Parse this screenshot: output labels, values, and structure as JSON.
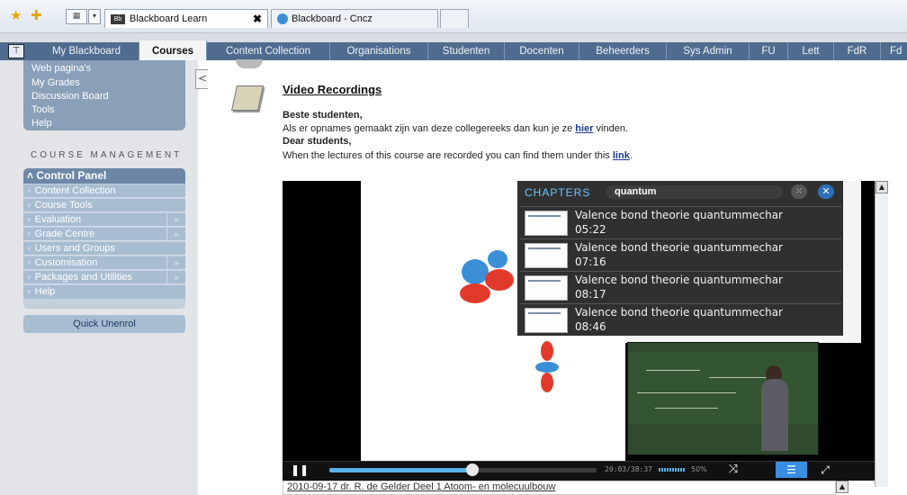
{
  "browser": {
    "tabs": [
      {
        "label": "Blackboard Learn",
        "favicon": "Bb"
      },
      {
        "label": "Blackboard - Cncz"
      },
      {
        "label": ""
      }
    ],
    "close_glyph": "✖"
  },
  "nav": {
    "tabs": [
      "My Blackboard",
      "Courses",
      "Content Collection",
      "Organisations",
      "Studenten",
      "Docenten",
      "Beheerders",
      "Sys Admin",
      "FU",
      "Lett",
      "FdR",
      "Fd"
    ],
    "active": "Courses"
  },
  "sidebar": {
    "tool_links": [
      "Web pagina's",
      "My Grades",
      "Discussion Board",
      "Tools",
      "Help"
    ],
    "collapse_glyph": "<",
    "course_management_heading": "COURSE MANAGEMENT",
    "control_panel": {
      "title": "Control Panel",
      "items": [
        {
          "label": "Content Collection",
          "has_submenu": false
        },
        {
          "label": "Course Tools",
          "has_submenu": false
        },
        {
          "label": "Evaluation",
          "has_submenu": true
        },
        {
          "label": "Grade Centre",
          "has_submenu": true
        },
        {
          "label": "Users and Groups",
          "has_submenu": false
        },
        {
          "label": "Customisation",
          "has_submenu": true
        },
        {
          "label": "Packages and Utilities",
          "has_submenu": true
        },
        {
          "label": "Help",
          "has_submenu": false
        }
      ],
      "submenu_glyph": "»",
      "expand_glyph": "»"
    },
    "quick_unenrol": "Quick Unenrol"
  },
  "content": {
    "title": "Video Recordings",
    "greeting_nl": "Beste studenten,",
    "line_nl_before": "Als er opnames gemaakt zijn van deze collegereeks dan kun je ze ",
    "line_nl_link": "hier",
    "line_nl_after": " vinden.",
    "greeting_en": "Dear students,",
    "line_en_before": "When the lectures of this course are recorded you can find them under this ",
    "line_en_link": "link",
    "line_en_after": "."
  },
  "player": {
    "chapters_title": "CHAPTERS",
    "search_value": "quantum",
    "chapters": [
      {
        "name": "Valence bond theorie quantummechar",
        "time": "05:22"
      },
      {
        "name": "Valence bond theorie quantummechar",
        "time": "07:16"
      },
      {
        "name": "Valence bond theorie quantummechar",
        "time": "08:17"
      },
      {
        "name": "Valence bond theorie quantummechar",
        "time": "08:46"
      }
    ],
    "time_display": "20:03/38:37",
    "volume": "50%",
    "progress_fraction": 0.52,
    "recording_title": "2010-09-17  dr. R. de Gelder  Deel 1 Atoom- en molecuulbouw"
  },
  "colors": {
    "nav_strip": "#4f6c8f",
    "sidebar_accent": "#8a9fb8",
    "player_accent": "#3a8ee0"
  }
}
